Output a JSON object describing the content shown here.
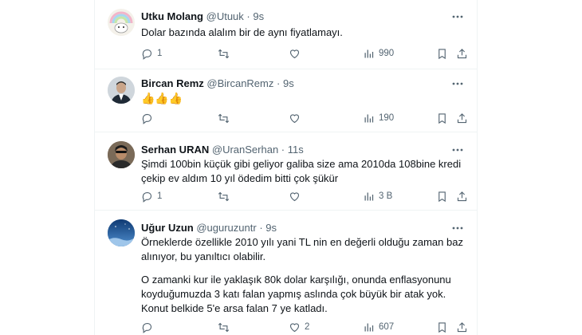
{
  "tweets": [
    {
      "name": "Utku Molang",
      "handle": "@Utuuk",
      "time": "9s",
      "text": "Dolar bazında alalım bir de aynı fiyatlamayı.",
      "replies": "1",
      "retweets": "",
      "likes": "",
      "views": "990"
    },
    {
      "name": "Bircan Remz",
      "handle": "@BircanRemz",
      "time": "9s",
      "text": "👍👍👍",
      "replies": "",
      "retweets": "",
      "likes": "",
      "views": "190"
    },
    {
      "name": "Serhan URAN",
      "handle": "@UranSerhan",
      "time": "11s",
      "text": "Şimdi 100bin küçük gibi geliyor galiba size ama 2010da 108bine kredi çekip ev aldım 10 yıl ödedim bitti çok şükür",
      "replies": "1",
      "retweets": "",
      "likes": "",
      "views": "3 B"
    },
    {
      "name": "Uğur Uzun",
      "handle": "@uguruzuntr",
      "time": "9s",
      "text": "Örneklerde özellikle 2010 yılı yani TL nin en değerli olduğu zaman baz alınıyor, bu yanıltıcı olabilir.",
      "text2": "O zamanki kur ile yaklaşık 80k dolar karşılığı, onunda enflasyonunu koyduğumuzda 3 katı falan yapmış aslında çok büyük bir atak yok. Konut belkide 5'e arsa falan 7 ye katladı.",
      "replies": "",
      "retweets": "",
      "likes": "2",
      "views": "607"
    }
  ],
  "colors": {
    "text": "#0f1419",
    "muted": "#536471",
    "border": "#eff3f4"
  },
  "icons": [
    "more-icon",
    "reply-icon",
    "retweet-icon",
    "like-icon",
    "views-icon",
    "bookmark-icon",
    "share-icon"
  ]
}
